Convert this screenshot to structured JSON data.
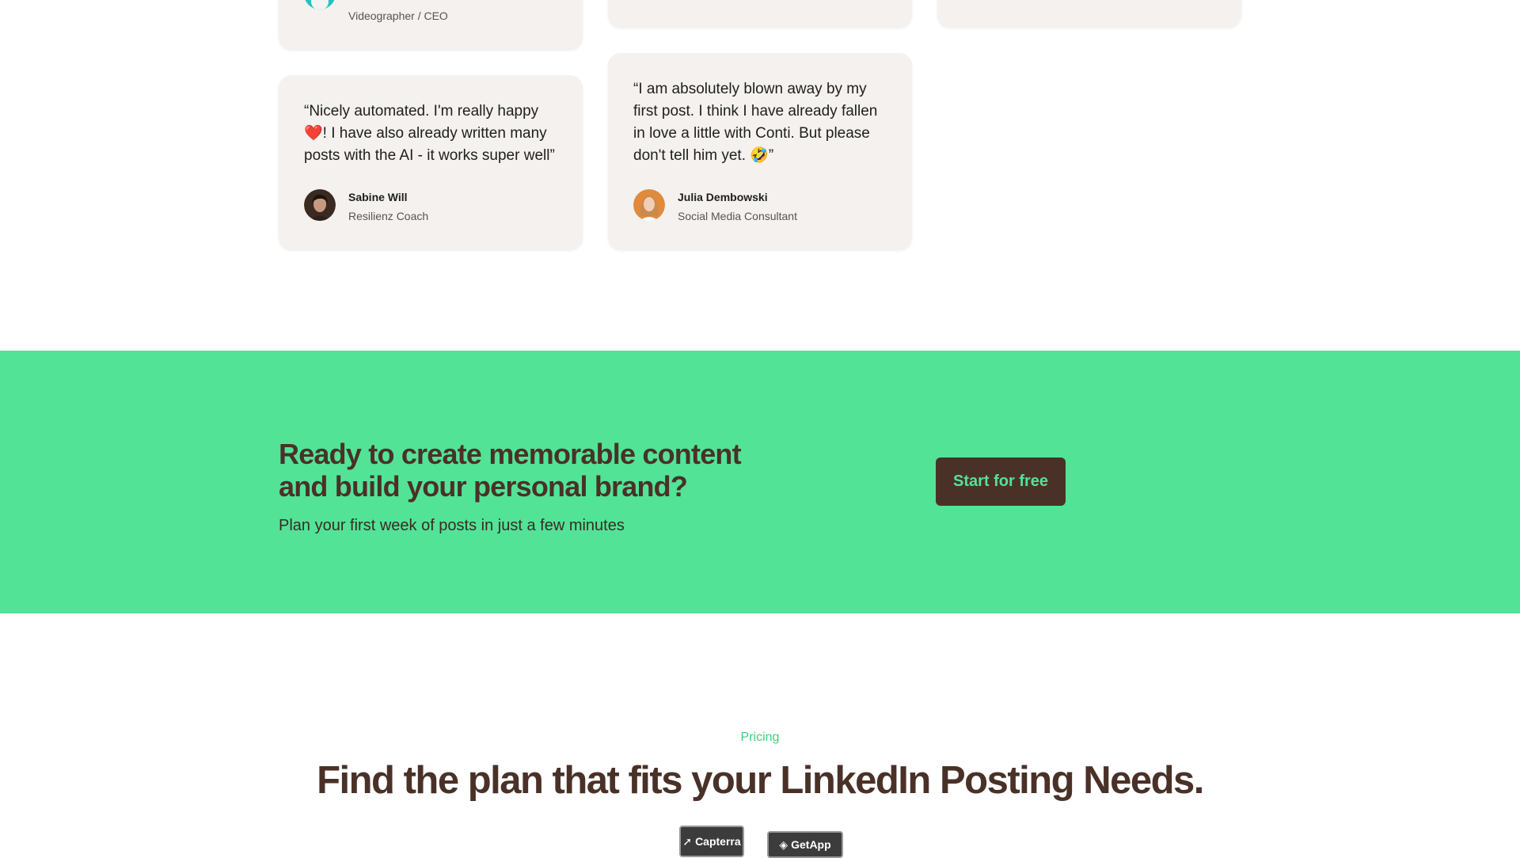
{
  "testimonials": [
    {
      "quote": "",
      "name": "",
      "role": "Videographer / CEO",
      "avatar_color": "#22c2c0"
    },
    {
      "quote": "“Nicely automated. I'm really happy ❤️! I have also already written many posts with the AI - it works super well”",
      "name": "Sabine Will",
      "role": "Resilienz Coach",
      "avatar_color": "#3a2a22"
    },
    {
      "quote": "“I am absolutely blown away by my first post. I think I have already fallen in love a little with Conti. But please don't tell him yet. 🤣”",
      "name": "Julia Dembowski",
      "role": "Social Media Consultant",
      "avatar_color": "#e08a3c"
    }
  ],
  "cta": {
    "title": "Ready to create memorable content and build your personal brand?",
    "subtitle": "Plan your first week of posts in just a few minutes",
    "button_label": "Start for free",
    "background_color": "#52e397",
    "button_color": "#4a3128"
  },
  "pricing": {
    "eyebrow": "Pricing",
    "title": "Find the plan that fits your LinkedIn Posting Needs."
  },
  "badges": [
    {
      "label": "Capterra",
      "icon": "capterra-arrow-icon"
    },
    {
      "label": "GetApp",
      "icon": "getapp-icon"
    }
  ]
}
